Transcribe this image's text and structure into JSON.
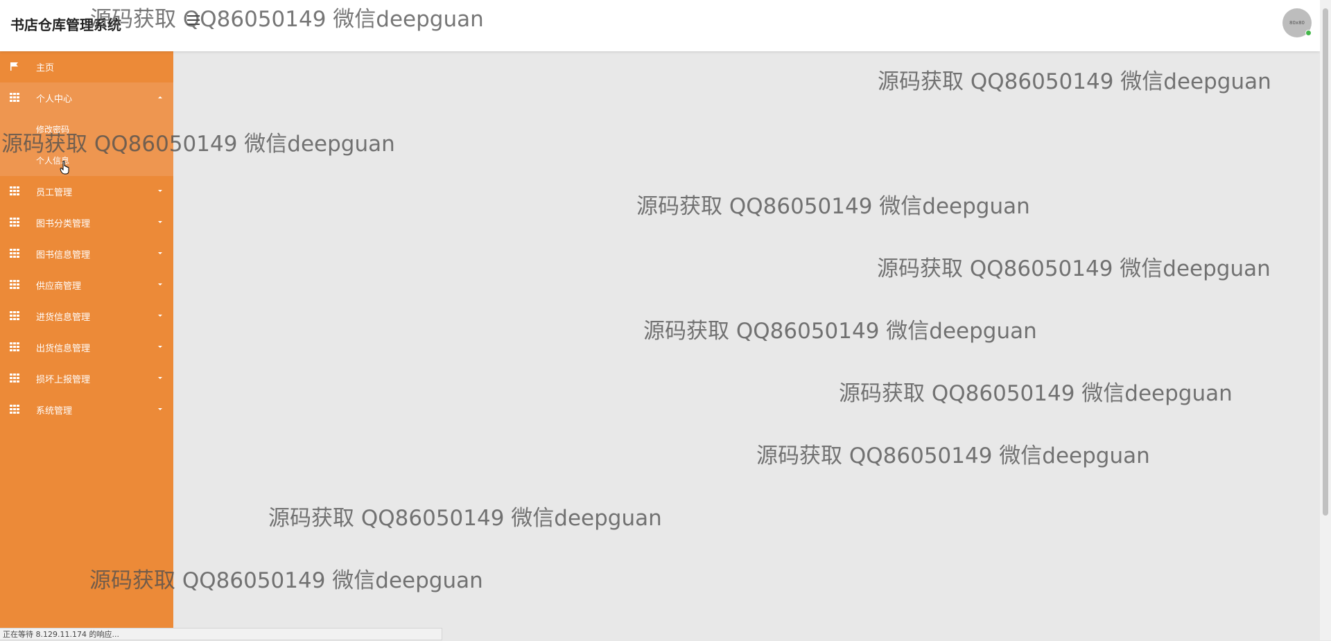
{
  "header": {
    "title": "书店仓库管理系统",
    "avatar_text": "80x80"
  },
  "sidebar": {
    "items": [
      {
        "label": "主页",
        "icon": "flag-icon"
      },
      {
        "label": "个人中心",
        "icon": "grid-icon",
        "expanded": true,
        "children": [
          {
            "label": "修改密码"
          },
          {
            "label": "个人信息"
          }
        ]
      },
      {
        "label": "员工管理",
        "icon": "grid-icon"
      },
      {
        "label": "图书分类管理",
        "icon": "grid-icon"
      },
      {
        "label": "图书信息管理",
        "icon": "grid-icon"
      },
      {
        "label": "供应商管理",
        "icon": "grid-icon"
      },
      {
        "label": "进货信息管理",
        "icon": "grid-icon"
      },
      {
        "label": "出货信息管理",
        "icon": "grid-icon"
      },
      {
        "label": "损坏上报管理",
        "icon": "grid-icon"
      },
      {
        "label": "系统管理",
        "icon": "grid-icon"
      }
    ]
  },
  "statusbar": {
    "text": "正在等待 8.129.11.174 的响应..."
  },
  "watermark": {
    "text": "源码获取 QQ86050149 微信deepguan"
  },
  "colors": {
    "sidebar": "#ec8a38",
    "sidebar_active": "#ee9650",
    "content_bg": "#e8e8e8"
  }
}
